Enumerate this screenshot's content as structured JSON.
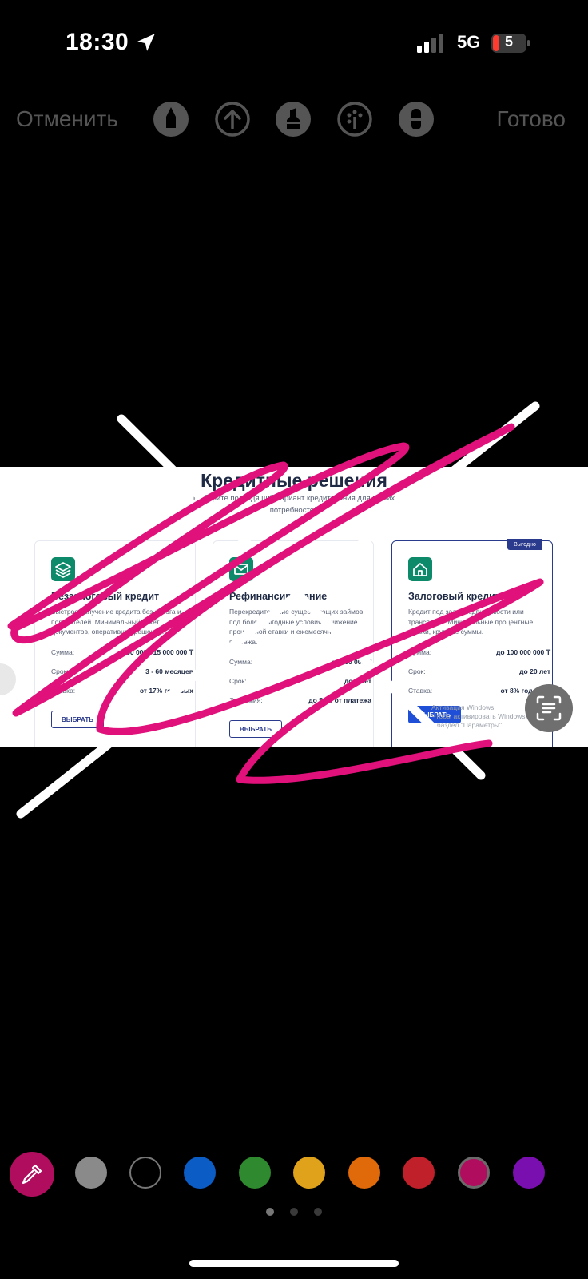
{
  "status_bar": {
    "time": "18:30",
    "network": "5G",
    "battery": "5"
  },
  "toolbar": {
    "cancel_label": "Отменить",
    "done_label": "Готово",
    "tools": [
      "pen-icon",
      "arrow-up-icon",
      "highlighter-icon",
      "palette-icon",
      "eraser-icon"
    ]
  },
  "screenshot": {
    "title": "Кредитные решения",
    "subtitle": "Выберите подходящий вариант кредитования для ваших потребностей",
    "badge": "Выгодно",
    "watermark_line1": "Активация Windows",
    "watermark_line2": "Чтобы активировать Windows, перейдите",
    "watermark_line3": "в раздел \"Параметры\".",
    "cards": [
      {
        "title": "Беззалоговый кредит",
        "description": "Быстрое получение кредита без залога и поручителей. Минимальный пакет документов, оперативное решение.",
        "rows": [
          {
            "label": "Сумма:",
            "value": "50 000 - 15 000 000 ₸"
          },
          {
            "label": "Срок:",
            "value": "3 - 60 месяцев"
          },
          {
            "label": "Ставка:",
            "value": "от 17% годовых"
          }
        ],
        "button": "ВЫБРАТЬ"
      },
      {
        "title": "Рефинансирование",
        "description": "Перекредитование существующих займов под более выгодные условия. Снижение процентной ставки и ежемесячного платежа.",
        "rows": [
          {
            "label": "Сумма:",
            "value": "от 100 000 ₸"
          },
          {
            "label": "Срок:",
            "value": "до 7 лет"
          },
          {
            "label": "Экономия:",
            "value": "до 50% от платежа"
          }
        ],
        "button": "ВЫБРАТЬ"
      },
      {
        "title": "Залоговый кредит",
        "description": "Кредит под залог недвижимости или транспорта. Минимальные процентные ставки, крупные суммы.",
        "rows": [
          {
            "label": "Сумма:",
            "value": "до 100 000 000 ₸"
          },
          {
            "label": "Срок:",
            "value": "до 20 лет"
          },
          {
            "label": "Ставка:",
            "value": "от 8% годовых"
          }
        ],
        "button": "ВЫБРАТЬ"
      }
    ]
  },
  "palette": {
    "selected_color": "#b00d5e",
    "colors": [
      "#8a8a8a",
      "#000000",
      "#0b5cc4",
      "#2f8a2f",
      "#e0a21a",
      "#e06a0a",
      "#c0202a",
      "#b00d5e",
      "#7a0fb0"
    ]
  },
  "annotation_colors": {
    "pen": "#e0117a",
    "lines": "#ffffff"
  },
  "page_dots": 3
}
